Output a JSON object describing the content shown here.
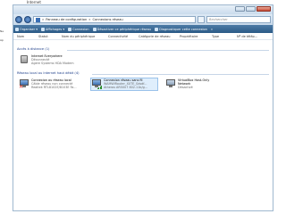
{
  "top_label": "Internet",
  "left_pane": [
    "Ne",
    "Ap"
  ],
  "address": {
    "path_sep": "»",
    "crumb1": "Panneau de configuration",
    "crumb2": "Connexions réseau",
    "search_placeholder": "Rechercher"
  },
  "toolbar": [
    {
      "label": "Organiser ▾",
      "icon": "organize-icon"
    },
    {
      "label": "Affichages ▾",
      "icon": "views-icon"
    },
    {
      "label": "Connexion",
      "icon": "connect-icon"
    },
    {
      "label": "Désactiver ce périphérique réseau",
      "icon": "disable-icon"
    },
    {
      "label": "Diagnostiquer cette connexion",
      "icon": "diagnose-icon"
    },
    {
      "label": "»",
      "icon": ""
    }
  ],
  "columns": [
    "Nom",
    "Statut",
    "Nom du périphérique",
    "Connectivité",
    "Catégorie de réseau",
    "Propriétaire",
    "Type",
    "Nº de télép..."
  ],
  "groups": {
    "remote": "Accès à distance (1)",
    "lan": "Réseau local ou Internet haut débit (4)"
  },
  "items": {
    "dialup": {
      "title": "Internet Everywhere",
      "status": "Déconnecté",
      "device": "Agere Systems HDA Modem"
    },
    "lan": {
      "title": "Connexion au réseau local",
      "status": "Câble réseau non connecté",
      "device": "Realtek RTL8102E/8103E Fa..."
    },
    "wifi": {
      "title": "Connexion réseau sans fil",
      "status": "WAMWiRouter_XXTE_Sdsdf...",
      "device": "Atheros AR5007 802.11b/g..."
    },
    "vbox": {
      "title": "VirtualBox Host-Only",
      "status": "Network",
      "device": "Désactivé"
    }
  },
  "colors": {
    "toolbar": "#2b5a86",
    "group_header": "#1e3f8a",
    "selection": "#dfeefc",
    "error_x": "#d01c14"
  }
}
